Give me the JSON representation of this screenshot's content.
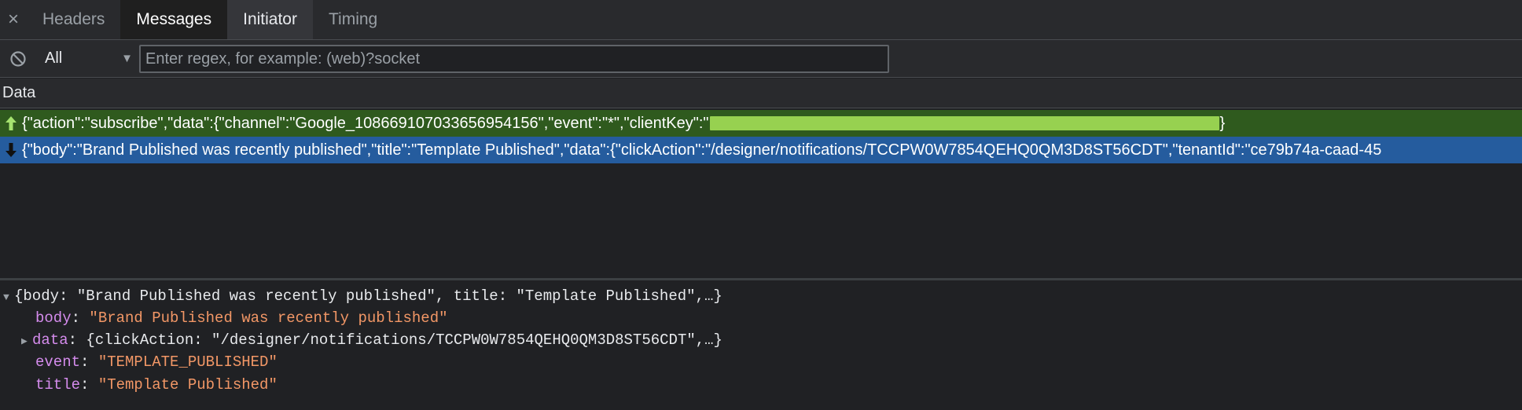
{
  "tabs": {
    "close_glyph": "×",
    "items": [
      "Headers",
      "Messages",
      "Initiator",
      "Timing"
    ]
  },
  "filter": {
    "type_value": "All",
    "regex_placeholder": "Enter regex, for example: (web)?socket"
  },
  "grid": {
    "header": "Data",
    "rows": [
      {
        "direction": "sent",
        "icon": "arrow-up-icon",
        "text_before": "{\"action\":\"subscribe\",\"data\":{\"channel\":\"Google_108669107033656954156\",\"event\":\"*\",\"clientKey\":\"",
        "text_after": "}"
      },
      {
        "direction": "received",
        "icon": "arrow-down-icon",
        "text": "{\"body\":\"Brand Published was recently published\",\"title\":\"Template Published\",\"data\":{\"clickAction\":\"/designer/notifications/TCCPW0W7854QEHQ0QM3D8ST56CDT\",\"tenantId\":\"ce79b74a-caad-45"
      }
    ]
  },
  "preview": {
    "summary": "{body: \"Brand Published was recently published\", title: \"Template Published\",…}",
    "fields": [
      {
        "key": "body",
        "value": "\"Brand Published was recently published\""
      },
      {
        "key": "data",
        "value": "{clickAction: \"/designer/notifications/TCCPW0W7854QEHQ0QM3D8ST56CDT\",…}"
      },
      {
        "key": "event",
        "value": "\"TEMPLATE_PUBLISHED\""
      },
      {
        "key": "title",
        "value": "\"Template Published\""
      }
    ]
  },
  "colors": {
    "sent_row": "#2f5a1e",
    "received_row": "#255c9e",
    "redaction": "#97d150",
    "key": "#d58ced",
    "string": "#f29766"
  }
}
